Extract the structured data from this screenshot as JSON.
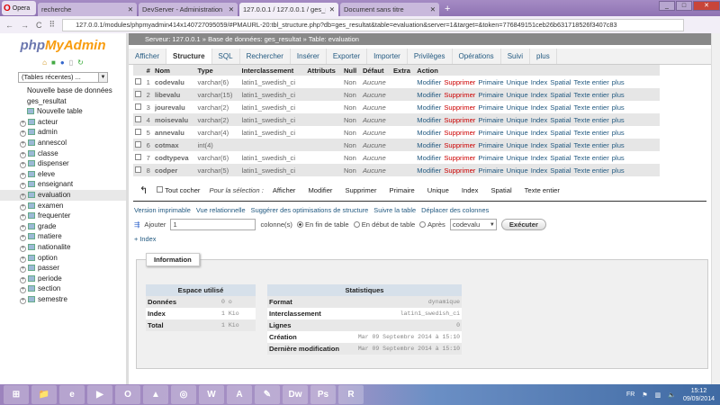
{
  "browser": {
    "opera_label": "Opera",
    "tabs": [
      {
        "title": "recherche"
      },
      {
        "title": "DevServer - Administration"
      },
      {
        "title": "127.0.0.1 / 127.0.0.1 / ges_r"
      },
      {
        "title": "Document sans titre"
      }
    ],
    "url": "127.0.0.1/modules/phpmyadmin414x140727095059/#PMAURL-20:tbl_structure.php?db=ges_resultat&table=evaluation&server=1&target=&token=776849151ceb26b631718526f3407c83"
  },
  "sidebar": {
    "logo_php": "php",
    "logo_my": "MyAdmin",
    "recent": "(Tables récentes) ...",
    "new_db": "Nouvelle base de données",
    "db": "ges_resultat",
    "new_table": "Nouvelle table",
    "tables": [
      "acteur",
      "admin",
      "annescol",
      "classe",
      "dispenser",
      "eleve",
      "enseignant",
      "evaluation",
      "examen",
      "frequenter",
      "grade",
      "matiere",
      "nationalite",
      "option",
      "passer",
      "periode",
      "section",
      "semestre"
    ],
    "selected": "evaluation"
  },
  "breadcrumb": {
    "server": "Serveur: 127.0.0.1",
    "db": "Base de données: ges_resultat",
    "table": "Table: evaluation"
  },
  "menu": [
    "Afficher",
    "Structure",
    "SQL",
    "Rechercher",
    "Insérer",
    "Exporter",
    "Importer",
    "Privilèges",
    "Opérations",
    "Suivi",
    "plus"
  ],
  "structure": {
    "headers": [
      "#",
      "Nom",
      "Type",
      "Interclassement",
      "Attributs",
      "Null",
      "Défaut",
      "Extra",
      "Action"
    ],
    "rows": [
      {
        "n": "1",
        "name": "codevalu",
        "type": "varchar(6)",
        "coll": "latin1_swedish_ci",
        "null": "Non",
        "def": "Aucune"
      },
      {
        "n": "2",
        "name": "libevalu",
        "type": "varchar(15)",
        "coll": "latin1_swedish_ci",
        "null": "Non",
        "def": "Aucune"
      },
      {
        "n": "3",
        "name": "jourevalu",
        "type": "varchar(2)",
        "coll": "latin1_swedish_ci",
        "null": "Non",
        "def": "Aucune"
      },
      {
        "n": "4",
        "name": "moisevalu",
        "type": "varchar(2)",
        "coll": "latin1_swedish_ci",
        "null": "Non",
        "def": "Aucune"
      },
      {
        "n": "5",
        "name": "annevalu",
        "type": "varchar(4)",
        "coll": "latin1_swedish_ci",
        "null": "Non",
        "def": "Aucune"
      },
      {
        "n": "6",
        "name": "cotmax",
        "type": "int(4)",
        "coll": "",
        "null": "Non",
        "def": "Aucune"
      },
      {
        "n": "7",
        "name": "codtypeva",
        "type": "varchar(6)",
        "coll": "latin1_swedish_ci",
        "null": "Non",
        "def": "Aucune"
      },
      {
        "n": "8",
        "name": "codper",
        "type": "varchar(5)",
        "coll": "latin1_swedish_ci",
        "null": "Non",
        "def": "Aucune"
      }
    ],
    "actions": [
      "Modifier",
      "Supprimer",
      "Primaire",
      "Unique",
      "Index",
      "Spatial",
      "Texte entier",
      "plus"
    ]
  },
  "bulk": {
    "check_all": "Tout cocher",
    "for_selection": "Pour la sélection :",
    "actions": [
      "Afficher",
      "Modifier",
      "Supprimer",
      "Primaire",
      "Unique",
      "Index",
      "Spatial",
      "Texte entier"
    ]
  },
  "links": [
    "Version imprimable",
    "Vue relationnelle",
    "Suggérer des optimisations de structure",
    "Suivre la table",
    "Déplacer des colonnes"
  ],
  "add": {
    "label": "Ajouter",
    "value": "1",
    "columns": "colonne(s)",
    "opt_end": "En fin de table",
    "opt_start": "En début de table",
    "opt_after": "Après",
    "after_col": "codevalu",
    "execute": "Exécuter"
  },
  "index_link": "+ Index",
  "info": {
    "legend": "Information",
    "space": {
      "title": "Espace utilisé",
      "rows": [
        [
          "Données",
          "0",
          "o"
        ],
        [
          "Index",
          "1",
          "Kio"
        ],
        [
          "Total",
          "1",
          "Kio"
        ]
      ]
    },
    "stats": {
      "title": "Statistiques",
      "rows": [
        [
          "Format",
          "dynamique"
        ],
        [
          "Interclassement",
          "latin1_swedish_ci"
        ],
        [
          "Lignes",
          "0"
        ],
        [
          "Création",
          "Mar 09 Septembre 2014 à 15:10"
        ],
        [
          "Dernière modification",
          "Mar 09 Septembre 2014 à 15:10"
        ]
      ]
    }
  },
  "taskbar": {
    "apps": [
      "Démarrer",
      "Explorateur",
      "IE",
      "Media",
      "Opera",
      "VLC",
      "Chrome",
      "Word",
      "Acrobat",
      "Bloc-notes",
      "Dw",
      "Ps",
      "R"
    ],
    "lang": "FR",
    "time": "15:12",
    "date": "09/09/2014"
  }
}
